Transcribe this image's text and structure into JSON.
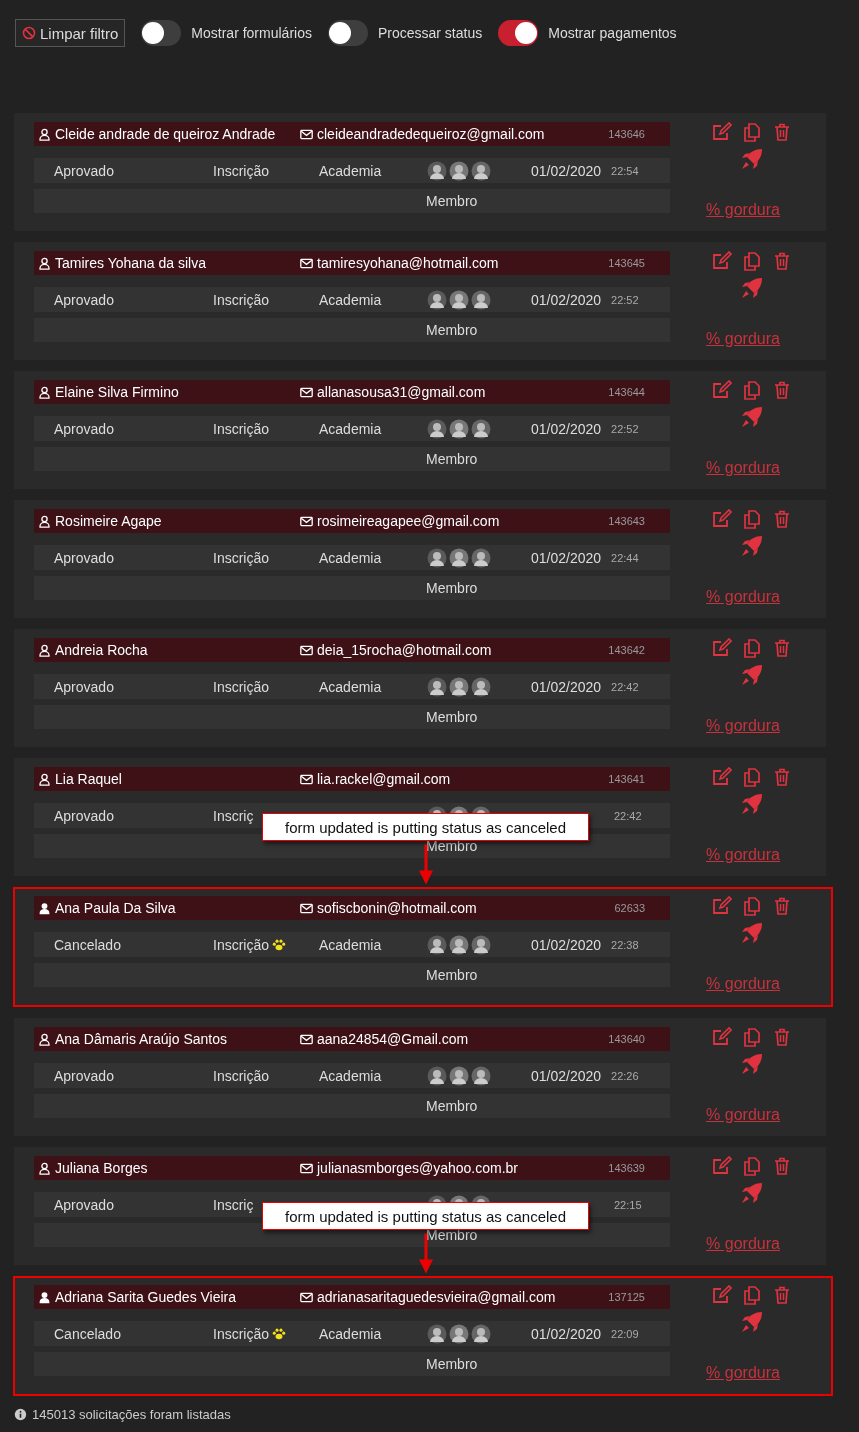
{
  "toolbar": {
    "clear_filter": "Limpar filtro",
    "toggles": [
      {
        "label": "Mostrar formulários",
        "on": false
      },
      {
        "label": "Processar status",
        "on": false
      },
      {
        "label": "Mostrar pagamentos",
        "on": true
      }
    ]
  },
  "requests": [
    {
      "name": "Cleide andrade de queiroz Andrade",
      "email": "cleideandradedequeiroz@gmail.com",
      "id": "143646",
      "status": "Aprovado",
      "type": "Inscrição",
      "paw": false,
      "category": "Academia",
      "date": "01/02/2020",
      "time": "22:54",
      "role": "Membro",
      "link": "% gordura",
      "highlighted": false
    },
    {
      "name": "Tamires Yohana da silva",
      "email": "tamiresyohana@hotmail.com",
      "id": "143645",
      "status": "Aprovado",
      "type": "Inscrição",
      "paw": false,
      "category": "Academia",
      "date": "01/02/2020",
      "time": "22:52",
      "role": "Membro",
      "link": "% gordura",
      "highlighted": false
    },
    {
      "name": "Elaine Silva Firmino",
      "email": "allanasousa31@gmail.com",
      "id": "143644",
      "status": "Aprovado",
      "type": "Inscrição",
      "paw": false,
      "category": "Academia",
      "date": "01/02/2020",
      "time": "22:52",
      "role": "Membro",
      "link": "% gordura",
      "highlighted": false
    },
    {
      "name": "Rosimeire Agape",
      "email": "rosimeireagapee@gmail.com",
      "id": "143643",
      "status": "Aprovado",
      "type": "Inscrição",
      "paw": false,
      "category": "Academia",
      "date": "01/02/2020",
      "time": "22:44",
      "role": "Membro",
      "link": "% gordura",
      "highlighted": false
    },
    {
      "name": "Andreia Rocha",
      "email": "deia_15rocha@hotmail.com",
      "id": "143642",
      "status": "Aprovado",
      "type": "Inscrição",
      "paw": false,
      "category": "Academia",
      "date": "01/02/2020",
      "time": "22:42",
      "role": "Membro",
      "link": "% gordura",
      "highlighted": false
    },
    {
      "name": "Lia Raquel",
      "email": "lia.rackel@gmail.com",
      "id": "143641",
      "status": "Aprovado",
      "type": "Inscriç",
      "paw": false,
      "time": "22:42",
      "role": "Membro",
      "link": "% gordura",
      "highlighted": false
    },
    {
      "name": "Ana Paula Da Silva",
      "email": "sofiscbonin@hotmail.com",
      "id": "62633",
      "status": "Cancelado",
      "type": "Inscrição",
      "paw": true,
      "category": "Academia",
      "date": "01/02/2020",
      "time": "22:38",
      "role": "Membro",
      "link": "% gordura",
      "highlighted": true,
      "callout": "form updated is putting status as canceled"
    },
    {
      "name": "Ana Dâmaris Araújo Santos",
      "email": "aana24854@Gmail.com",
      "id": "143640",
      "status": "Aprovado",
      "type": "Inscrição",
      "paw": false,
      "category": "Academia",
      "date": "01/02/2020",
      "time": "22:26",
      "role": "Membro",
      "link": "% gordura",
      "highlighted": false
    },
    {
      "name": "Juliana Borges",
      "email": "julianasmborges@yahoo.com.br",
      "id": "143639",
      "status": "Aprovado",
      "type": "Inscriç",
      "paw": false,
      "time": "22:15",
      "role": "Membro",
      "link": "% gordura",
      "highlighted": false
    },
    {
      "name": "Adriana Sarita Guedes Vieira",
      "email": "adrianasaritaguedesvieira@gmail.com",
      "id": "137125",
      "status": "Cancelado",
      "type": "Inscrição",
      "paw": true,
      "category": "Academia",
      "date": "01/02/2020",
      "time": "22:09",
      "role": "Membro",
      "link": "% gordura",
      "highlighted": true,
      "callout": "form updated is putting status as canceled"
    }
  ],
  "footer": "145013 solicitações foram listadas"
}
